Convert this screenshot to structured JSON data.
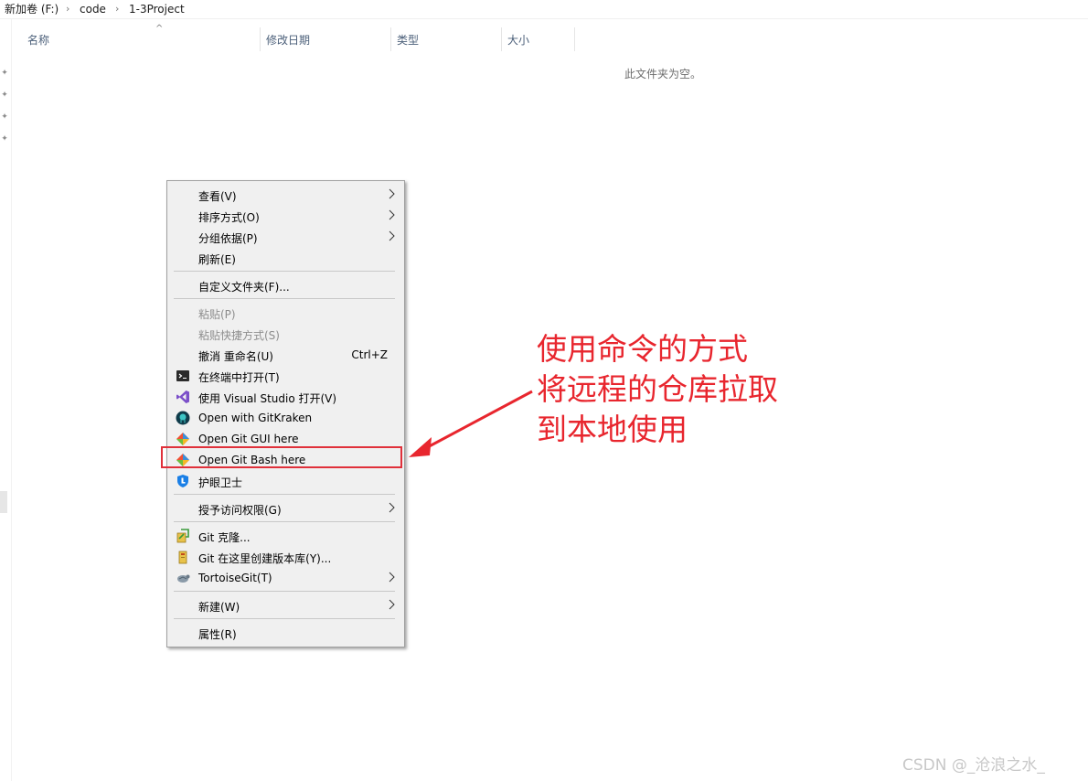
{
  "breadcrumb": {
    "items": [
      "新加卷 (F:)",
      "code",
      "1-3Project"
    ],
    "separator": "›"
  },
  "columns": [
    "名称",
    "修改日期",
    "类型",
    "大小"
  ],
  "empty_message": "此文件夹为空。",
  "context_menu": {
    "view": "查看(V)",
    "sort": "排序方式(O)",
    "group": "分组依据(P)",
    "refresh": "刷新(E)",
    "customize": "自定义文件夹(F)...",
    "paste": "粘贴(P)",
    "paste_shortcut": "粘贴快捷方式(S)",
    "undo_rename": "撤消 重命名(U)",
    "undo_shortcut": "Ctrl+Z",
    "open_terminal": "在终端中打开(T)",
    "open_vs": "使用 Visual Studio 打开(V)",
    "open_gitkraken": "Open with GitKraken",
    "open_git_gui": "Open Git GUI here",
    "open_git_bash": "Open Git Bash here",
    "eye_guard": "护眼卫士",
    "grant_access": "授予访问权限(G)",
    "git_clone": "Git 克隆...",
    "git_create_repo": "Git 在这里创建版本库(Y)...",
    "tortoisegit": "TortoiseGit(T)",
    "new": "新建(W)",
    "properties": "属性(R)"
  },
  "annotation": {
    "lines": [
      "使用命令的方式",
      "将远程的仓库拉取",
      "到本地使用"
    ],
    "color": "#e8262e"
  },
  "watermark": "CSDN @_沧浪之水_"
}
